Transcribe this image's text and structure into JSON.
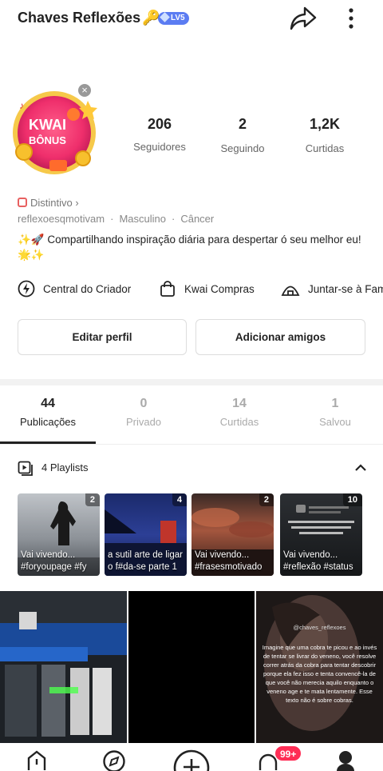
{
  "header": {
    "username": "Chaves Reflexões",
    "level_badge": "LV5"
  },
  "avatar": {
    "kwai_text": "KWAI",
    "bonus_text": "BÔNUS"
  },
  "stats": [
    {
      "value": "206",
      "label": "Seguidores"
    },
    {
      "value": "2",
      "label": "Seguindo"
    },
    {
      "value": "1,2K",
      "label": "Curtidas"
    }
  ],
  "profile": {
    "distintivo": "Distintivo",
    "handle": "reflexoesqmotivam",
    "gender": "Masculino",
    "sign": "Câncer",
    "bio_line1": "✨🚀 Compartilhando inspiração diária para despertar ó seu melhor eu!",
    "bio_line2": "🌟✨"
  },
  "quick_links": [
    "Central do Criador",
    "Kwai Compras",
    "Juntar-se à Família"
  ],
  "buttons": {
    "edit": "Editar perfil",
    "add_friends": "Adicionar amigos"
  },
  "tabs": [
    {
      "count": "44",
      "label": "Publicações",
      "active": true
    },
    {
      "count": "0",
      "label": "Privado"
    },
    {
      "count": "14",
      "label": "Curtidas"
    },
    {
      "count": "1",
      "label": "Salvou"
    }
  ],
  "playlists": {
    "header": "4 Playlists",
    "items": [
      {
        "count": "2",
        "line1": "Vai vivendo...",
        "line2": "#foryoupage #fy"
      },
      {
        "count": "4",
        "line1": "a sutil arte de ligar",
        "line2": "o f#da-se parte 1"
      },
      {
        "count": "2",
        "line1": "Vai vivendo...",
        "line2": "#frasesmotivado"
      },
      {
        "count": "10",
        "line1": "Vai vivendo...",
        "line2": "#reflexão #status"
      }
    ]
  },
  "grid": {
    "third_text": "Imagine que uma cobra te picou e ao invés de tentar se livrar do veneno, você resolve correr atrás da cobra para tentar descobrir porque ela fez isso e tenta convencê-la de que você não merecia aquilo enquanto o veneno age e te mata lentamente. Esse texto não é sobre cobras.",
    "third_tag": "@chaves_reflexoes"
  },
  "bottom_nav": {
    "badge": "99+"
  }
}
